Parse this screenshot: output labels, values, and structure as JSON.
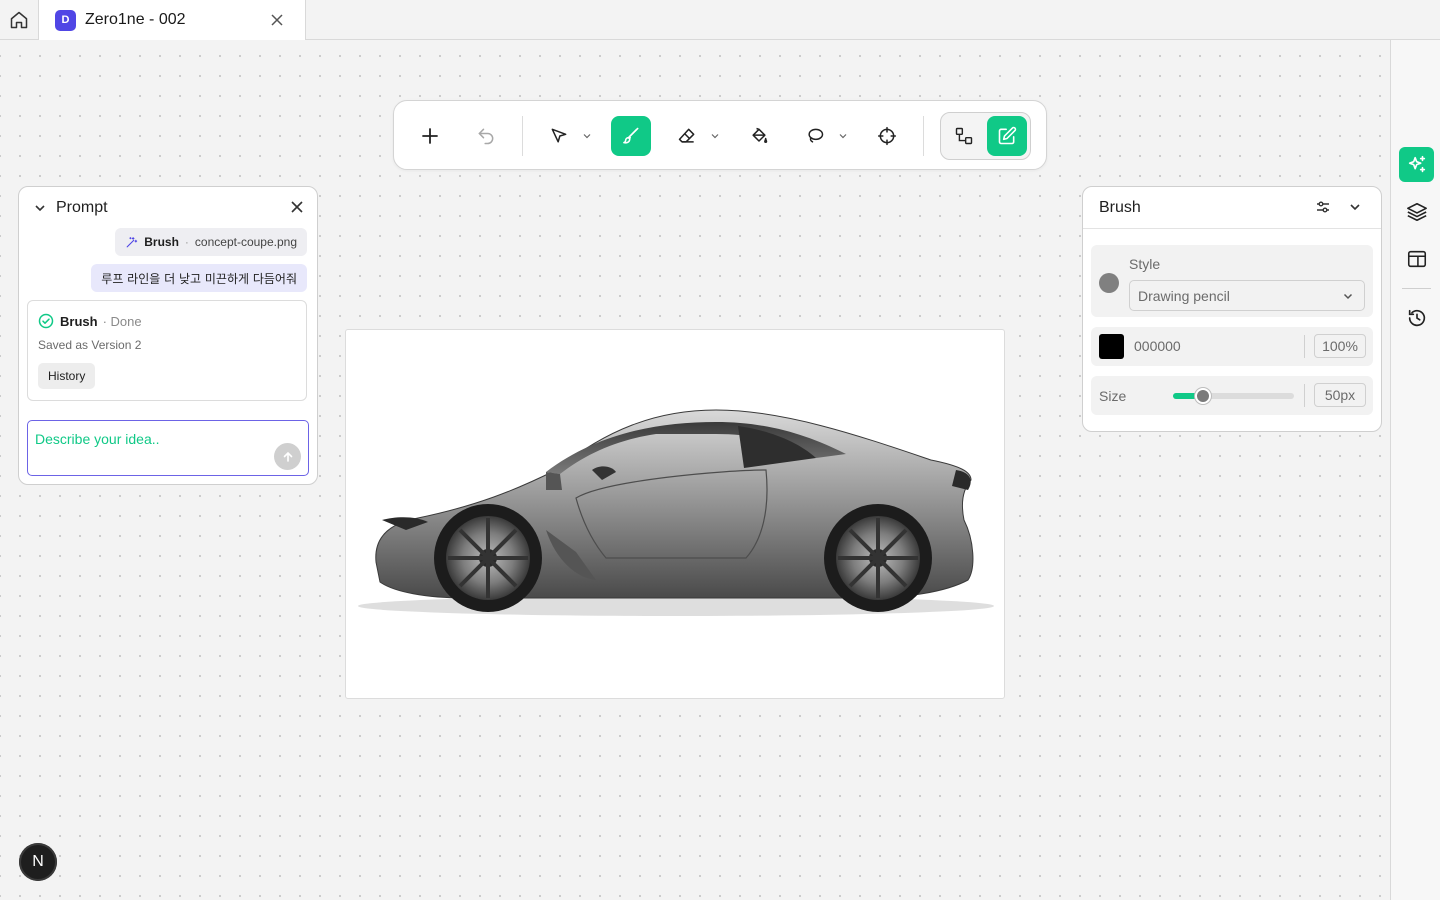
{
  "tab": {
    "badge": "D",
    "title": "Zero1ne - 002"
  },
  "toolbar": {
    "tools": [
      "add",
      "undo",
      "select",
      "brush",
      "eraser",
      "fill",
      "lasso",
      "target",
      "node-mode",
      "edit-mode"
    ],
    "active_tool": "brush",
    "accent": "#10c987"
  },
  "prompt": {
    "title": "Prompt",
    "file_chip": {
      "tool": "Brush",
      "file": "concept-coupe.png"
    },
    "message": "루프 라인을 더 낮고 미끈하게 다듬어줘",
    "result": {
      "tool": "Brush",
      "status": "· Done",
      "saved": "Saved as Version 2",
      "history_label": "History"
    },
    "input": {
      "placeholder": "Describe your idea.."
    }
  },
  "brush": {
    "title": "Brush",
    "style_label": "Style",
    "style_value": "Drawing pencil",
    "color_hex": "000000",
    "opacity": "100%",
    "size_label": "Size",
    "size_value": "50px",
    "size_slider_fraction": 0.25
  },
  "avatar": {
    "initial": "N"
  },
  "colors": {
    "accent": "#10c987",
    "brand": "#5046e5"
  }
}
